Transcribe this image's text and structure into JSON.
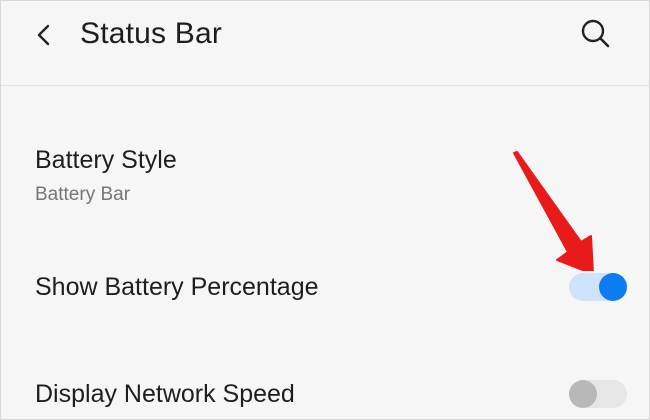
{
  "header": {
    "title": "Status Bar",
    "back_icon": "back-chevron-icon",
    "search_icon": "search-icon"
  },
  "settings": [
    {
      "title": "Battery Style",
      "subtitle": "Battery Bar"
    },
    {
      "title": "Show Battery Percentage",
      "toggle": true
    },
    {
      "title": "Display Network Speed",
      "toggle": false
    }
  ],
  "annotation": {
    "arrow_color": "#e81a1a"
  },
  "colors": {
    "accent": "#0c7cf0",
    "toggle_on_track": "#cfe3fb",
    "toggle_off_track": "#e6e6e6",
    "toggle_off_knob": "#b8b8b8"
  }
}
